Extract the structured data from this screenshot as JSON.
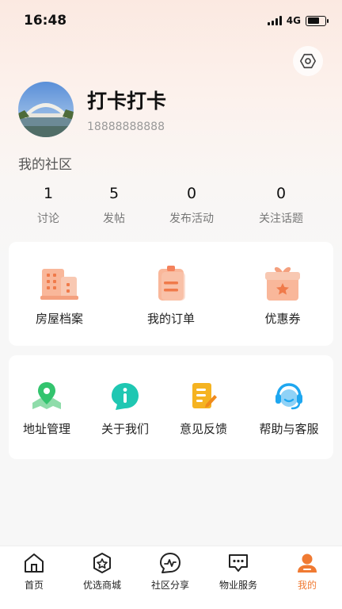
{
  "status_bar": {
    "time": "16:48",
    "network": "4G"
  },
  "user": {
    "name": "打卡打卡",
    "phone": "18888888888"
  },
  "community": {
    "title": "我的社区",
    "stats": [
      {
        "value": "1",
        "label": "讨论"
      },
      {
        "value": "5",
        "label": "发帖"
      },
      {
        "value": "0",
        "label": "发布活动"
      },
      {
        "value": "0",
        "label": "关注话题"
      }
    ]
  },
  "quick_links": [
    {
      "label": "房屋档案",
      "icon": "building-icon"
    },
    {
      "label": "我的订单",
      "icon": "order-clipboard-icon"
    },
    {
      "label": "优惠券",
      "icon": "gift-coupon-icon"
    }
  ],
  "services": [
    {
      "label": "地址管理",
      "icon": "map-pin-icon"
    },
    {
      "label": "关于我们",
      "icon": "info-icon"
    },
    {
      "label": "意见反馈",
      "icon": "feedback-edit-icon"
    },
    {
      "label": "帮助与客服",
      "icon": "headset-icon"
    }
  ],
  "tabbar": [
    {
      "label": "首页",
      "icon": "home-icon",
      "active": false
    },
    {
      "label": "优选商城",
      "icon": "star-badge-icon",
      "active": false
    },
    {
      "label": "社区分享",
      "icon": "chat-pulse-icon",
      "active": false
    },
    {
      "label": "物业服务",
      "icon": "message-dots-icon",
      "active": false
    },
    {
      "label": "我的",
      "icon": "person-icon",
      "active": true
    }
  ],
  "colors": {
    "accent": "#f07a32",
    "coral": "#f4825c",
    "green": "#33c46e",
    "teal": "#1fc7b2",
    "yellow": "#f5b321",
    "blue": "#1ea7f0"
  }
}
